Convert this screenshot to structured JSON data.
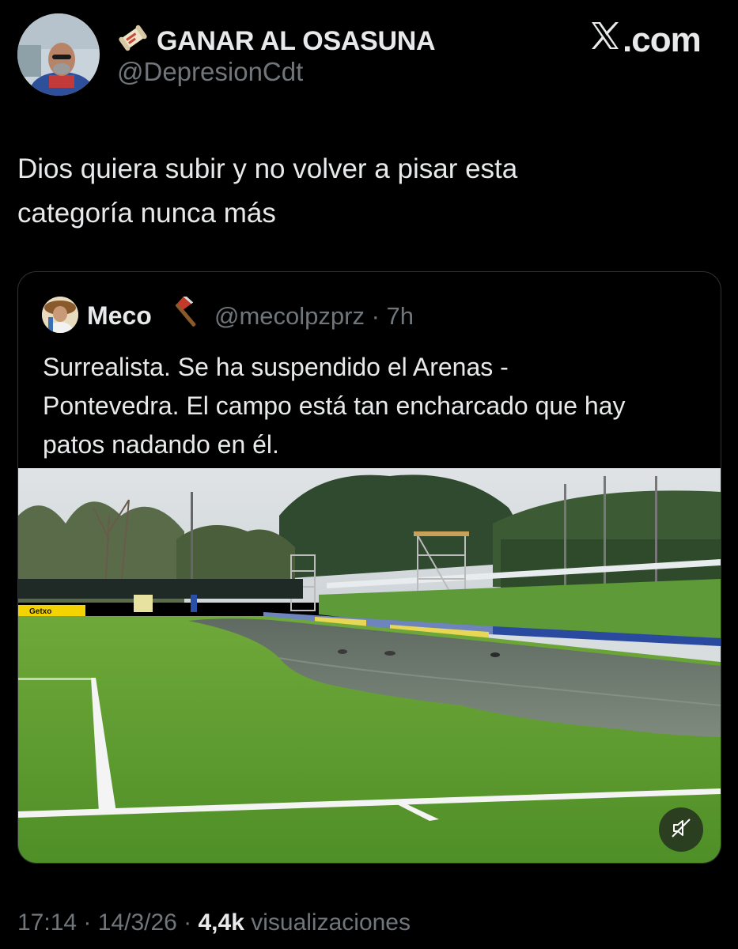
{
  "header": {
    "author_name": "GANAR AL OSASUNA",
    "author_handle": "@DepresionCdt",
    "site_logo_text": ".com"
  },
  "tweet": {
    "text_line1": "Dios quiera subir y no volver a pisar esta",
    "text_line2": "categoría nunca más"
  },
  "quote": {
    "author_name": "Meco",
    "author_handle": "@mecolpzprz · 7h",
    "text_line1": "Surrealista. Se ha suspendido el Arenas -",
    "text_line2": "Pontevedra. El campo está tan encharcado que hay",
    "text_line3": "patos nadando en él.",
    "media": {
      "board_text": "Getxo",
      "mute_icon": "speaker-muted-icon"
    }
  },
  "meta": {
    "time_date": "17:14 · 14/3/26 · ",
    "views_count": "4,4k",
    "views_label": " visualizaciones"
  }
}
